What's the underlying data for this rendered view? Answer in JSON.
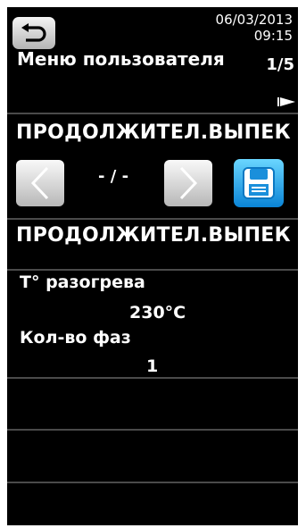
{
  "header": {
    "date": "06/03/2013",
    "time": "09:15",
    "title": "Меню пользователя",
    "page_indicator": "1/5"
  },
  "program": {
    "name_top": "ПРОДОЛЖИТЕЛ.ВЫПЕК",
    "counter": "- / -",
    "name_selected": "ПРОДОЛЖИТЕЛ.ВЫПЕК"
  },
  "params": [
    {
      "label": "T° разогрева",
      "value": "230°C"
    },
    {
      "label": "Кол-во фаз",
      "value": "1"
    }
  ],
  "icons": {
    "back": "back-arrow-icon",
    "play": "play-icon",
    "prev": "chevron-left-icon",
    "next": "chevron-right-icon",
    "save": "floppy-disk-icon"
  },
  "colors": {
    "background": "#000000",
    "text": "#ffffff",
    "divider": "#4a4a4a",
    "save_accent": "#1a9ae6"
  }
}
